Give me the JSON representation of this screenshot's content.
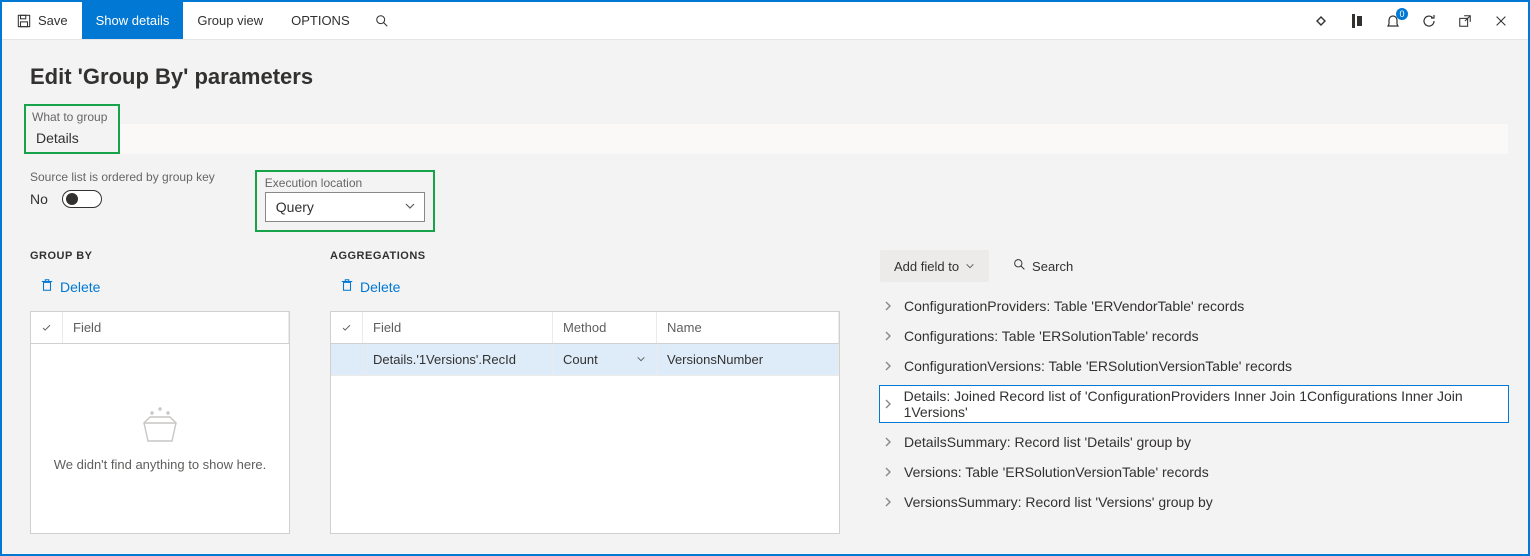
{
  "toolbar": {
    "save": "Save",
    "show_details": "Show details",
    "group_view": "Group view",
    "options": "OPTIONS",
    "bell_count": "0"
  },
  "page": {
    "title": "Edit 'Group By' parameters"
  },
  "fields": {
    "what_to_group_label": "What to group",
    "what_to_group_value": "Details",
    "ordered_label": "Source list is ordered by group key",
    "ordered_value": "No",
    "exec_label": "Execution location",
    "exec_value": "Query"
  },
  "sections": {
    "group_by": "GROUP BY",
    "aggregations": "AGGREGATIONS"
  },
  "actions": {
    "delete": "Delete",
    "add_field_to": "Add field to",
    "search": "Search"
  },
  "groupby_grid": {
    "field_header": "Field",
    "empty_msg": "We didn't find anything to show here."
  },
  "agg_grid": {
    "field_header": "Field",
    "method_header": "Method",
    "name_header": "Name",
    "rows": [
      {
        "field": "Details.'1Versions'.RecId",
        "method": "Count",
        "name": "VersionsNumber"
      }
    ]
  },
  "tree": {
    "items": [
      "ConfigurationProviders: Table 'ERVendorTable' records",
      "Configurations: Table 'ERSolutionTable' records",
      "ConfigurationVersions: Table 'ERSolutionVersionTable' records",
      "Details: Joined Record list of 'ConfigurationProviders Inner Join 1Configurations Inner Join 1Versions'",
      "DetailsSummary: Record list 'Details' group by",
      "Versions: Table 'ERSolutionVersionTable' records",
      "VersionsSummary: Record list 'Versions' group by"
    ],
    "selected_index": 3
  }
}
